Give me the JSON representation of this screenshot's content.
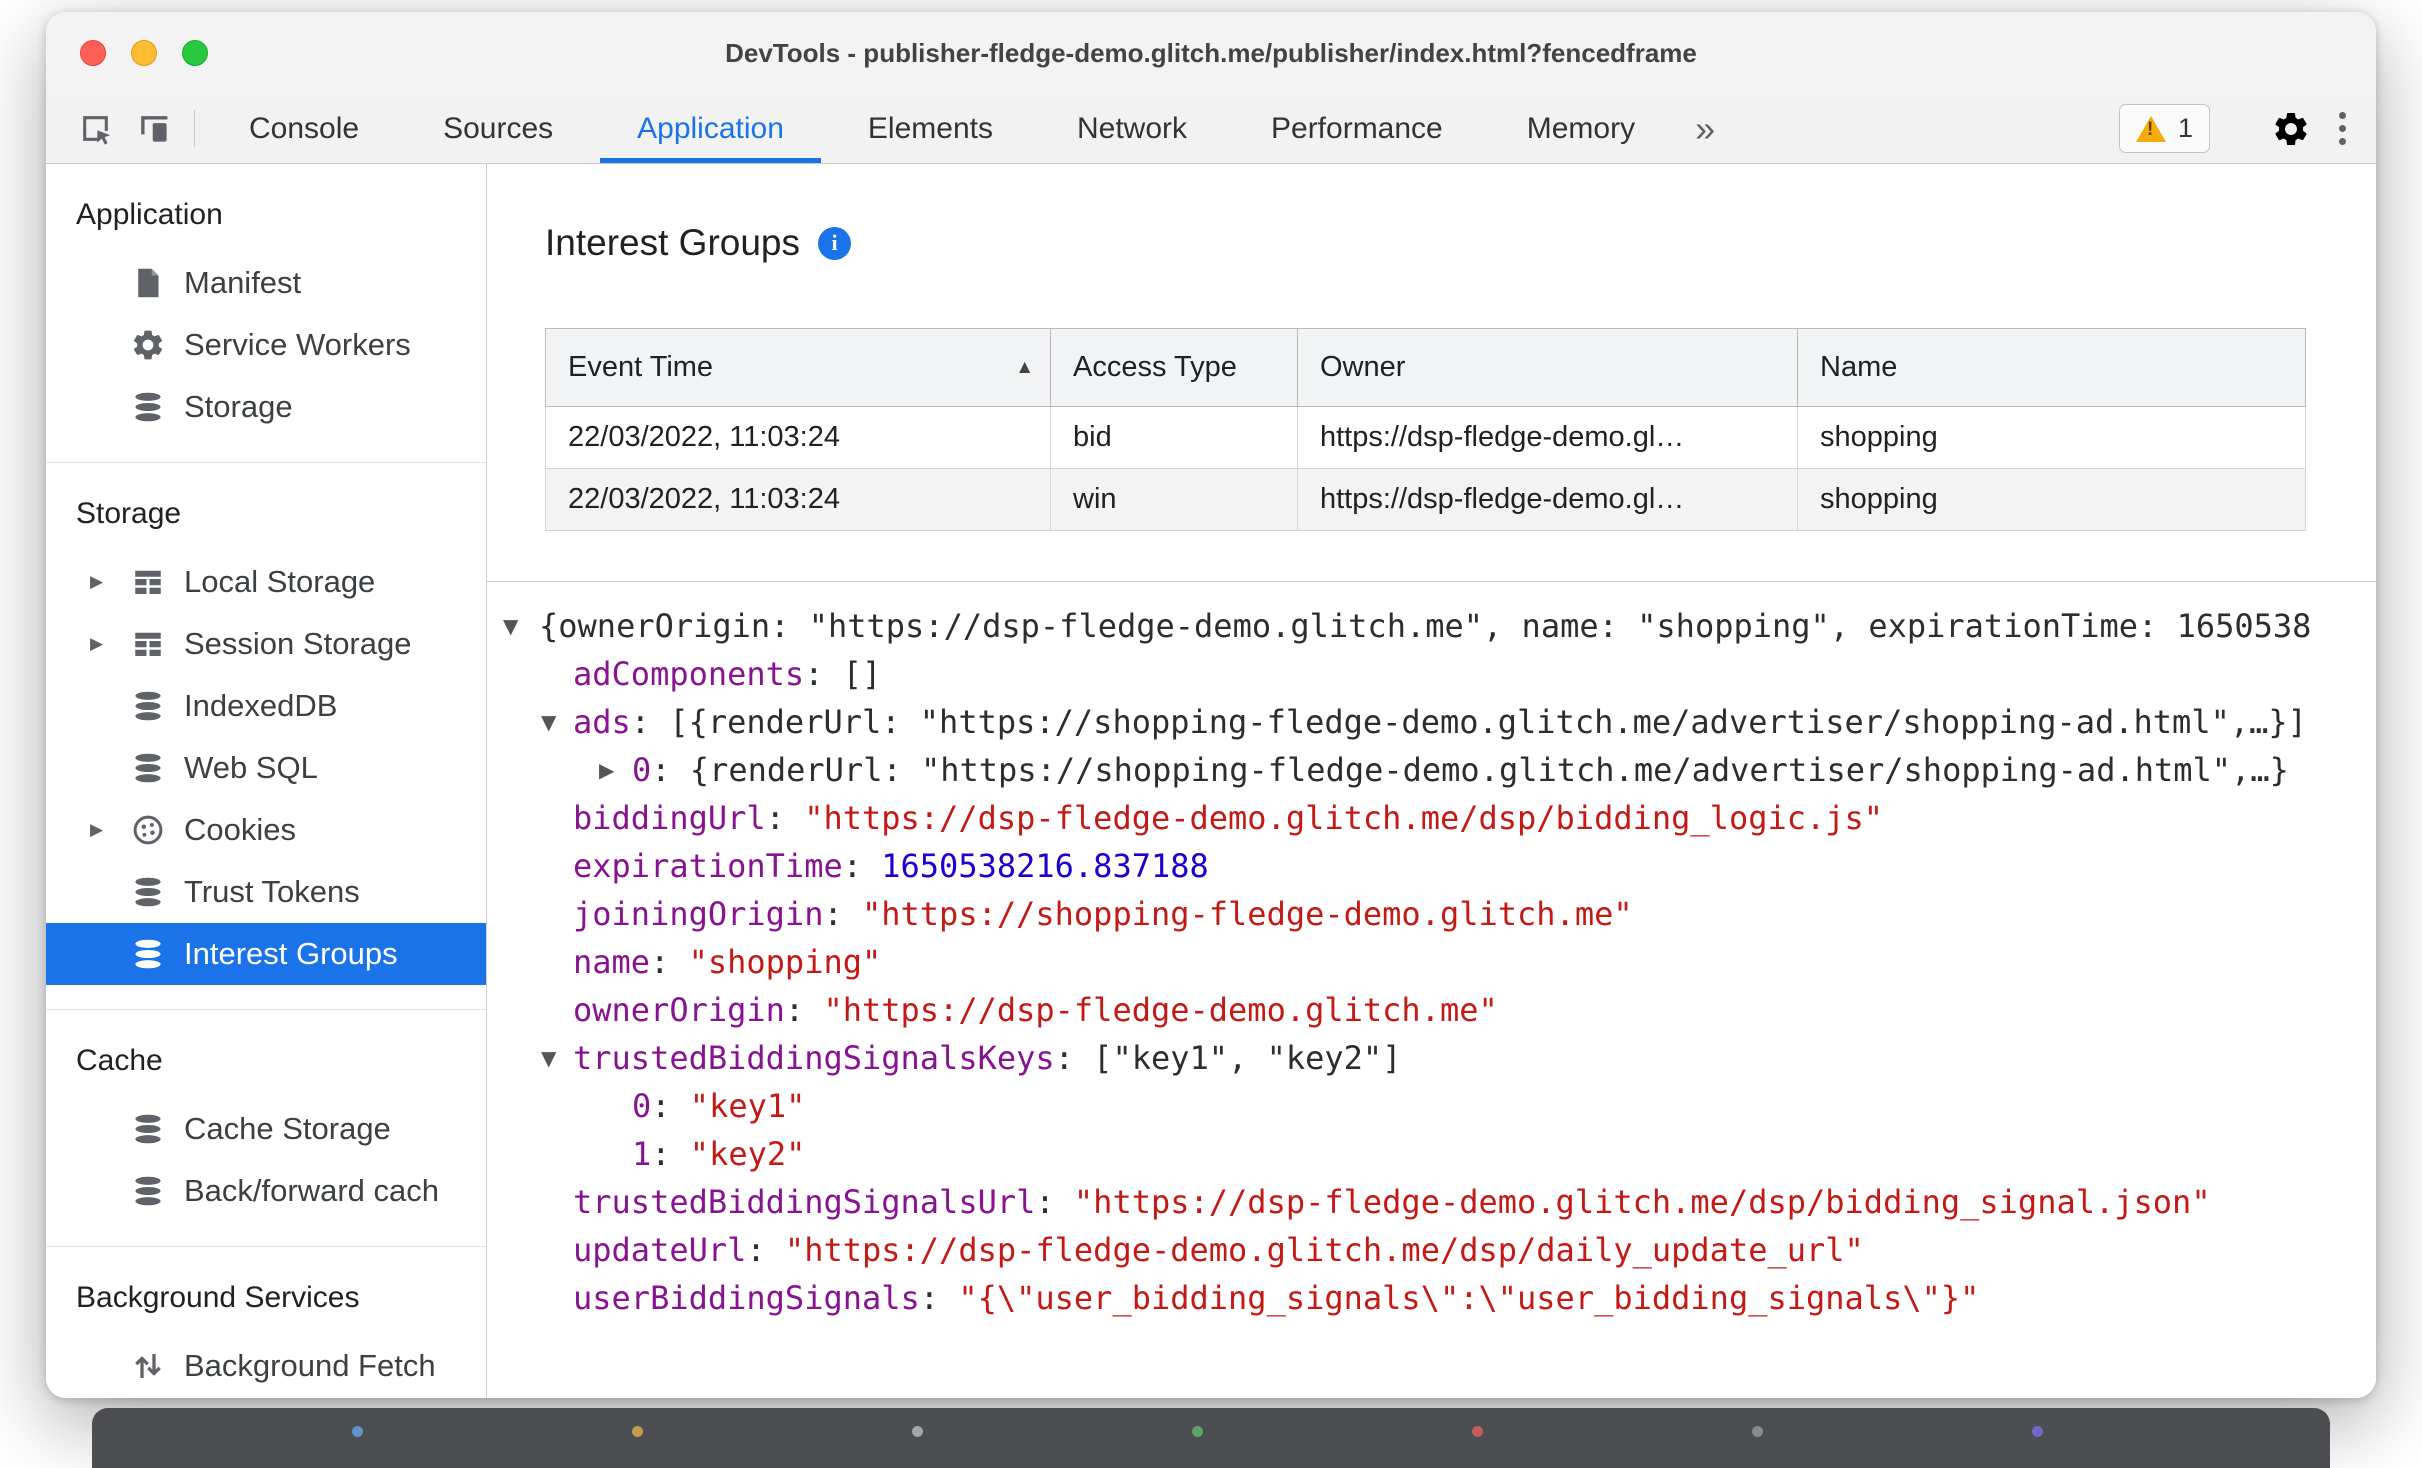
{
  "window": {
    "title": "DevTools - publisher-fledge-demo.glitch.me/publisher/index.html?fencedframe"
  },
  "toolbar": {
    "left_icons": [
      "inspect-icon",
      "device-toolbar-icon"
    ],
    "tabs": [
      {
        "label": "Console",
        "active": false
      },
      {
        "label": "Sources",
        "active": false
      },
      {
        "label": "Application",
        "active": true
      },
      {
        "label": "Elements",
        "active": false
      },
      {
        "label": "Network",
        "active": false
      },
      {
        "label": "Performance",
        "active": false
      },
      {
        "label": "Memory",
        "active": false
      }
    ],
    "more_tabs_label": "»",
    "warning_count": "1",
    "right_icons": [
      "warning-icon",
      "gear-icon",
      "kebab-menu-icon"
    ]
  },
  "sidebar": {
    "sections": [
      {
        "title": "Application",
        "items": [
          {
            "label": "Manifest",
            "icon": "document-icon"
          },
          {
            "label": "Service Workers",
            "icon": "gear-icon"
          },
          {
            "label": "Storage",
            "icon": "database-icon"
          }
        ]
      },
      {
        "title": "Storage",
        "items": [
          {
            "label": "Local Storage",
            "icon": "table-icon",
            "expandable": true
          },
          {
            "label": "Session Storage",
            "icon": "table-icon",
            "expandable": true
          },
          {
            "label": "IndexedDB",
            "icon": "database-icon"
          },
          {
            "label": "Web SQL",
            "icon": "database-icon"
          },
          {
            "label": "Cookies",
            "icon": "cookie-icon",
            "expandable": true
          },
          {
            "label": "Trust Tokens",
            "icon": "database-icon"
          },
          {
            "label": "Interest Groups",
            "icon": "database-icon",
            "selected": true
          }
        ]
      },
      {
        "title": "Cache",
        "items": [
          {
            "label": "Cache Storage",
            "icon": "database-icon"
          },
          {
            "label": "Back/forward cach",
            "icon": "database-icon"
          }
        ]
      },
      {
        "title": "Background Services",
        "items": [
          {
            "label": "Background Fetch",
            "icon": "fetch-icon"
          }
        ]
      }
    ]
  },
  "main": {
    "title": "Interest Groups",
    "info_icon": "info-icon",
    "table": {
      "columns": [
        "Event Time",
        "Access Type",
        "Owner",
        "Name"
      ],
      "sorted_column": "Event Time",
      "sort_direction": "ascending",
      "rows": [
        [
          "22/03/2022, 11:03:24",
          "bid",
          "https://dsp-fledge-demo.gl…",
          "shopping"
        ],
        [
          "22/03/2022, 11:03:24",
          "win",
          "https://dsp-fledge-demo.gl…",
          "shopping"
        ]
      ]
    },
    "tree": [
      {
        "level": 0,
        "arrow": "down",
        "parts": [
          {
            "t": "{ownerOrigin: \"https://dsp-fledge-demo.glitch.me\", name: \"shopping\", expirationTime: 1650538",
            "c": "plain"
          }
        ]
      },
      {
        "level": 1,
        "arrow": null,
        "parts": [
          {
            "t": "adComponents",
            "c": "name"
          },
          {
            "t": ": []",
            "c": "plain"
          }
        ]
      },
      {
        "level": 1,
        "arrow": "down",
        "parts": [
          {
            "t": "ads",
            "c": "name"
          },
          {
            "t": ": [{renderUrl: \"https://shopping-fledge-demo.glitch.me/advertiser/shopping-ad.html\",…}]",
            "c": "plain"
          }
        ]
      },
      {
        "level": 2,
        "arrow": "right",
        "parts": [
          {
            "t": "0",
            "c": "name"
          },
          {
            "t": ": {renderUrl: \"https://shopping-fledge-demo.glitch.me/advertiser/shopping-ad.html\",…}",
            "c": "plain"
          }
        ]
      },
      {
        "level": 1,
        "arrow": null,
        "parts": [
          {
            "t": "biddingUrl",
            "c": "name"
          },
          {
            "t": ": ",
            "c": "plain"
          },
          {
            "t": "\"https://dsp-fledge-demo.glitch.me/dsp/bidding_logic.js\"",
            "c": "string"
          }
        ]
      },
      {
        "level": 1,
        "arrow": null,
        "parts": [
          {
            "t": "expirationTime",
            "c": "name"
          },
          {
            "t": ": ",
            "c": "plain"
          },
          {
            "t": "1650538216.837188",
            "c": "number"
          }
        ]
      },
      {
        "level": 1,
        "arrow": null,
        "parts": [
          {
            "t": "joiningOrigin",
            "c": "name"
          },
          {
            "t": ": ",
            "c": "plain"
          },
          {
            "t": "\"https://shopping-fledge-demo.glitch.me\"",
            "c": "string"
          }
        ]
      },
      {
        "level": 1,
        "arrow": null,
        "parts": [
          {
            "t": "name",
            "c": "name"
          },
          {
            "t": ": ",
            "c": "plain"
          },
          {
            "t": "\"shopping\"",
            "c": "string"
          }
        ]
      },
      {
        "level": 1,
        "arrow": null,
        "parts": [
          {
            "t": "ownerOrigin",
            "c": "name"
          },
          {
            "t": ": ",
            "c": "plain"
          },
          {
            "t": "\"https://dsp-fledge-demo.glitch.me\"",
            "c": "string"
          }
        ]
      },
      {
        "level": 1,
        "arrow": "down",
        "parts": [
          {
            "t": "trustedBiddingSignalsKeys",
            "c": "name"
          },
          {
            "t": ": [\"key1\", \"key2\"]",
            "c": "plain"
          }
        ]
      },
      {
        "level": 2,
        "arrow": null,
        "parts": [
          {
            "t": "0",
            "c": "name"
          },
          {
            "t": ": ",
            "c": "plain"
          },
          {
            "t": "\"key1\"",
            "c": "string"
          }
        ]
      },
      {
        "level": 2,
        "arrow": null,
        "parts": [
          {
            "t": "1",
            "c": "name"
          },
          {
            "t": ": ",
            "c": "plain"
          },
          {
            "t": "\"key2\"",
            "c": "string"
          }
        ]
      },
      {
        "level": 1,
        "arrow": null,
        "parts": [
          {
            "t": "trustedBiddingSignalsUrl",
            "c": "name"
          },
          {
            "t": ": ",
            "c": "plain"
          },
          {
            "t": "\"https://dsp-fledge-demo.glitch.me/dsp/bidding_signal.json\"",
            "c": "string"
          }
        ]
      },
      {
        "level": 1,
        "arrow": null,
        "parts": [
          {
            "t": "updateUrl",
            "c": "name"
          },
          {
            "t": ": ",
            "c": "plain"
          },
          {
            "t": "\"https://dsp-fledge-demo.glitch.me/dsp/daily_update_url\"",
            "c": "string"
          }
        ]
      },
      {
        "level": 1,
        "arrow": null,
        "parts": [
          {
            "t": "userBiddingSignals",
            "c": "name"
          },
          {
            "t": ": ",
            "c": "plain"
          },
          {
            "t": "\"{\\\"user_bidding_signals\\\":\\\"user_bidding_signals\\\"}\"",
            "c": "string"
          }
        ]
      }
    ]
  },
  "colors": {
    "accent": "#1a73e8",
    "selected_item_bg": "#1a73e8",
    "tree_name": "#881391",
    "tree_string": "#c41a16",
    "tree_number": "#1c00cf",
    "warning": "#f6ad0c",
    "traffic_red": "#ff5f57",
    "traffic_yellow": "#febc2e",
    "traffic_green": "#28c840"
  }
}
